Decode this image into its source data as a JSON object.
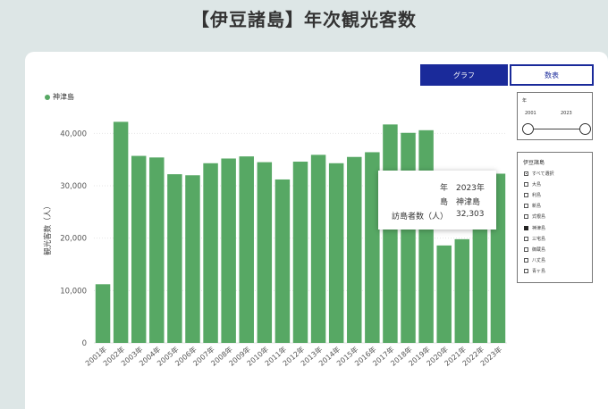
{
  "page": {
    "title": "【伊豆諸島】年次観光客数"
  },
  "buttons": {
    "graph": "グラフ",
    "table": "数表"
  },
  "year_slicer": {
    "label": "年",
    "min": "2001",
    "max": "2023"
  },
  "island_slicer": {
    "title": "伊豆諸島",
    "items": [
      {
        "label": "すべて選択",
        "state": "partial"
      },
      {
        "label": "大島",
        "state": "off"
      },
      {
        "label": "利島",
        "state": "off"
      },
      {
        "label": "新島",
        "state": "off"
      },
      {
        "label": "式根島",
        "state": "off"
      },
      {
        "label": "神津島",
        "state": "on"
      },
      {
        "label": "三宅島",
        "state": "off"
      },
      {
        "label": "御蔵島",
        "state": "off"
      },
      {
        "label": "八丈島",
        "state": "off"
      },
      {
        "label": "青ヶ島",
        "state": "off"
      }
    ]
  },
  "tooltip": {
    "rows": [
      {
        "key": "年",
        "value": "2023年"
      },
      {
        "key": "島",
        "value": "神津島"
      },
      {
        "key": "訪島者数（人）",
        "value": "32,303"
      }
    ]
  },
  "colors": {
    "bar": "#57a864",
    "accent": "#1a2a9a"
  },
  "chart_data": {
    "type": "bar",
    "ylabel": "観光客数（人）",
    "ylim": [
      0,
      45000
    ],
    "yticks": [
      0,
      10000,
      20000,
      30000,
      40000
    ],
    "ytick_labels": [
      "0",
      "10,000",
      "20,000",
      "30,000",
      "40,000"
    ],
    "grid": true,
    "legend_position": "top-left",
    "categories": [
      "2001年",
      "2002年",
      "2003年",
      "2004年",
      "2005年",
      "2006年",
      "2007年",
      "2008年",
      "2009年",
      "2010年",
      "2011年",
      "2012年",
      "2013年",
      "2014年",
      "2015年",
      "2016年",
      "2017年",
      "2018年",
      "2019年",
      "2020年",
      "2021年",
      "2022年",
      "2023年"
    ],
    "series": [
      {
        "name": "神津島",
        "values": [
          11200,
          42200,
          35700,
          35400,
          32200,
          32000,
          34300,
          35200,
          35600,
          34500,
          31200,
          34600,
          35900,
          34300,
          35500,
          36400,
          41700,
          40100,
          40600,
          18600,
          19800,
          22000,
          32303
        ]
      }
    ]
  }
}
